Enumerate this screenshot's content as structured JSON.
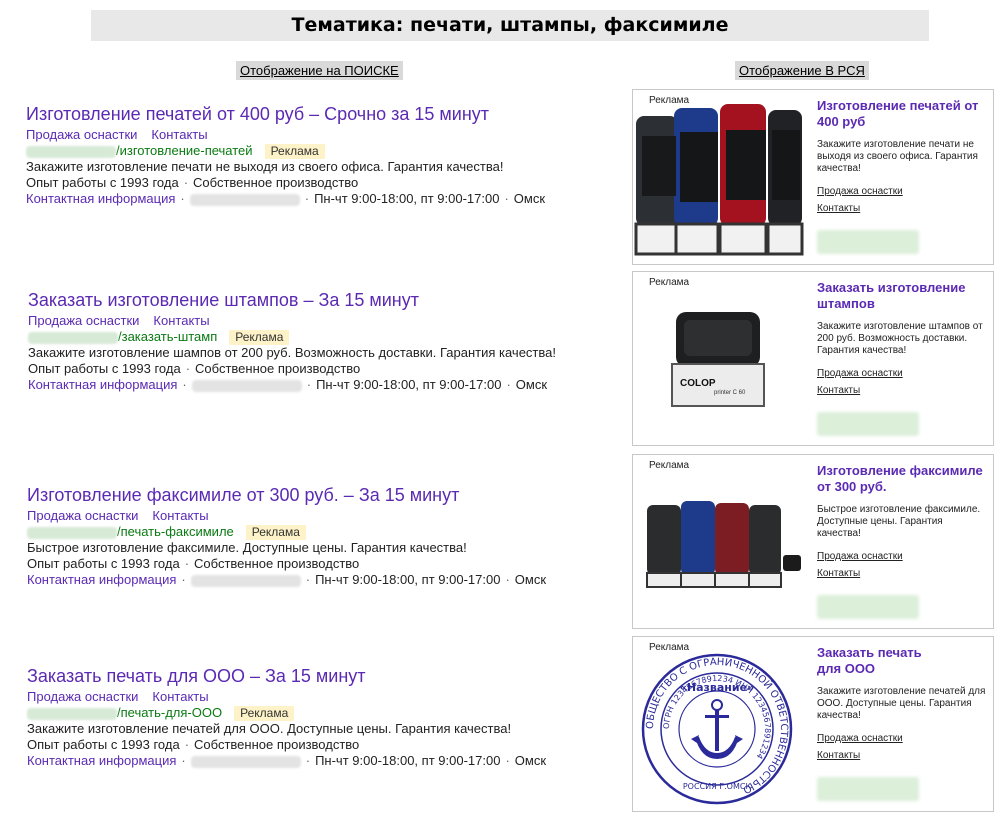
{
  "header": {
    "title": "Тематика: печати, штампы, факсимиле"
  },
  "labels": {
    "search": "Отображение на ПОИСКЕ",
    "rsa": "Отображение В РСЯ"
  },
  "common": {
    "link1": "Продажа оснастки",
    "link2": "Контакты",
    "badge": "Реклама",
    "experience": "Опыт работы с 1993 года",
    "production": "Собственное производство",
    "contact": "Контактная информация",
    "hours": "Пн-чт 9:00-18:00, пт 9:00-17:00",
    "city": "Омск",
    "dot": "·",
    "rsa_tag": "Реклама"
  },
  "search_ads": [
    {
      "title": "Изготовление печатей от 400 руб – Срочно за 15 минут",
      "path": "/изготовление-печатей",
      "text": "Закажите изготовление печати не выходя из своего офиса. Гарантия качества!"
    },
    {
      "title": "Заказать изготовление штампов – За 15 минут",
      "path": "/заказать-штамп",
      "text": "Закажите изготовление шампов от 200 руб. Возможность доставки. Гарантия качества!"
    },
    {
      "title": "Изготовление факсимиле от 300 руб. – За 15 минут",
      "path": "/печать-факсимиле",
      "text": "Быстрое изготовление факсимиле. Доступные цены. Гарантия качества!"
    },
    {
      "title": "Заказать печать для ООО – За 15 минут",
      "path": "/печать-для-ООО",
      "text": "Закажите изготовление печатей для ООО. Доступные цены. Гарантия качества!"
    }
  ],
  "rsa_ads": [
    {
      "title": "Изготовление печатей от 400 руб",
      "desc": "Закажите изготовление печати не выходя из своего офиса. Гарантия качества!",
      "image": "four-stamps-closeup"
    },
    {
      "title": "Заказать изготовление штампов",
      "desc": "Закажите изготовление штампов от 200 руб. Возможность доставки. Гарантия качества!",
      "image": "colop-stamp"
    },
    {
      "title": "Изготовление факсимиле от 300 руб.",
      "desc": "Быстрое изготовление факсимиле. Доступные цены. Гарантия качества!",
      "image": "four-stamps"
    },
    {
      "title": "Заказать печать для ООО",
      "desc": "Закажите изготовление печатей для ООО. Доступные цены. Гарантия качества!",
      "image": "round-seal-anchor"
    }
  ],
  "seal": {
    "outer_text": "ОБЩЕСТВО С ОГРАНИЧЕННОЙ ОТВЕТСТВЕННОСТЬЮ",
    "name": "«Название»",
    "ogrn": "ОГРН 1234567891234 ИНН 1234567891234",
    "bottom": "РОССИЯ Г.ОМСК",
    "color": "#2b2a9a"
  },
  "colors": {
    "link": "#5b2ab3",
    "url": "#0a7a12",
    "badge_bg": "#fdf2c8"
  }
}
